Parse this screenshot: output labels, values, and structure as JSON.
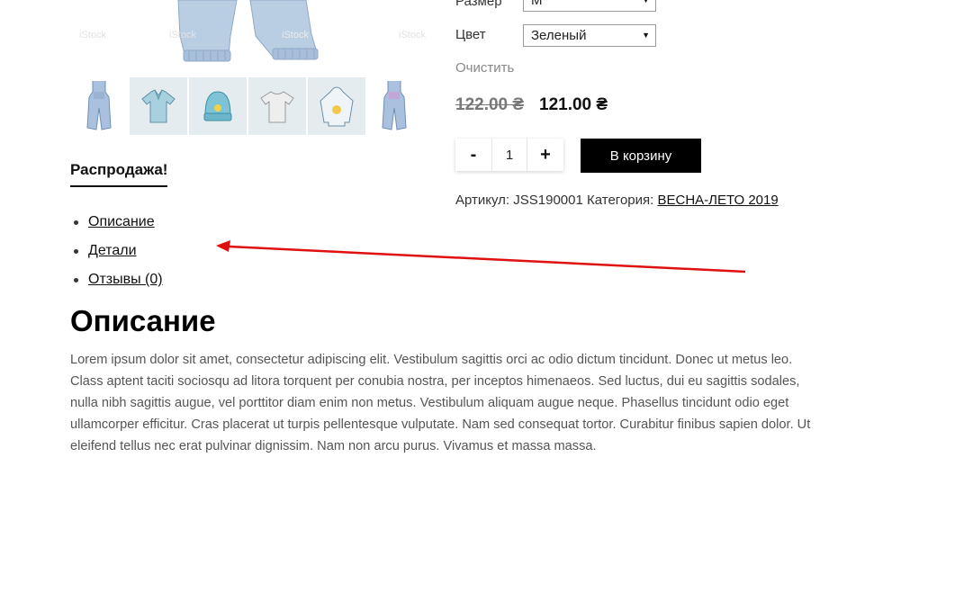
{
  "gallery": {
    "main_image_icon": "romper-jeans-image",
    "watermark": "iStock",
    "thumbnails": [
      {
        "icon": "denim-romper-icon",
        "color": "#9fb8d6"
      },
      {
        "icon": "polo-shirt-icon",
        "color": "#a9d0de"
      },
      {
        "icon": "beanie-icon",
        "color": "#7fc4d6"
      },
      {
        "icon": "tshirt-icon",
        "color": "#d9d9d9"
      },
      {
        "icon": "hoodie-icon",
        "color": "#d7e6ee"
      },
      {
        "icon": "denim-romper-icon",
        "color": "#9fb8d6"
      }
    ]
  },
  "product": {
    "size_label": "Размер",
    "size_value": "M",
    "color_label": "Цвет",
    "color_value": "Зеленый",
    "clear_label": "Очистить",
    "old_price": "122.00 ₴",
    "new_price": "121.00 ₴",
    "quantity": "1",
    "minus_label": "-",
    "plus_label": "+",
    "add_to_cart_label": "В корзину",
    "sku_label": "Артикул:",
    "sku_value": "JSS190001",
    "category_label": "Категория:",
    "category_value": "ВЕСНА-ЛЕТО 2019"
  },
  "sale_tab": {
    "label": "Распродажа!"
  },
  "tabs": [
    {
      "label": "Описание"
    },
    {
      "label": "Детали"
    },
    {
      "label": "Отзывы (0)"
    }
  ],
  "annotation": {
    "arrow_color": "#e01010"
  },
  "description": {
    "title": "Описание",
    "text": "Lorem ipsum dolor sit amet, consectetur adipiscing elit. Vestibulum sagittis orci ac odio dictum tincidunt. Donec ut metus leo. Class aptent taciti sociosqu ad litora torquent per conubia nostra, per inceptos himenaeos. Sed luctus, dui eu sagittis sodales, nulla nibh sagittis augue, vel porttitor diam enim non metus. Vestibulum aliquam augue neque. Phasellus tincidunt odio eget ullamcorper efficitur. Cras placerat ut turpis pellentesque vulputate. Nam sed consequat tortor. Curabitur finibus sapien dolor. Ut eleifend tellus nec erat pulvinar dignissim. Nam non arcu purus. Vivamus et massa massa."
  }
}
